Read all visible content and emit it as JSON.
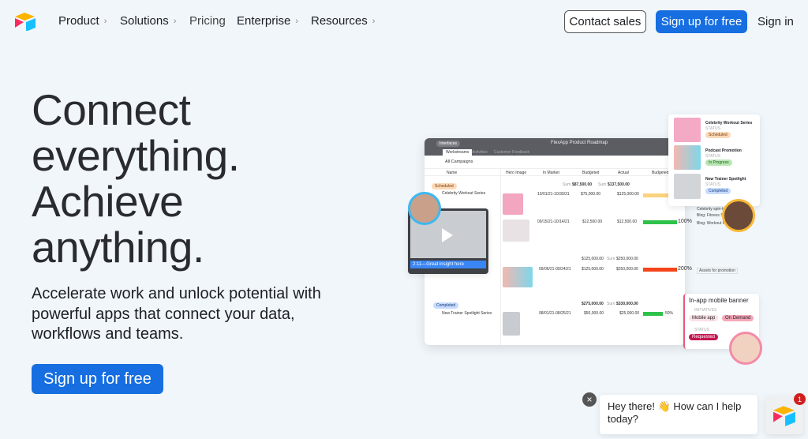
{
  "nav": {
    "items": [
      {
        "label": "Product",
        "chevron": true
      },
      {
        "label": "Solutions",
        "chevron": true
      },
      {
        "label": "Pricing",
        "chevron": false
      },
      {
        "label": "Enterprise",
        "chevron": true
      },
      {
        "label": "Resources",
        "chevron": true
      }
    ],
    "contact_sales": "Contact sales",
    "sign_up": "Sign up for free",
    "sign_in": "Sign in"
  },
  "hero": {
    "headline": [
      "Connect",
      "everything.",
      "Achieve",
      "anything."
    ],
    "subtitle": "Accelerate work and unlock potential with powerful apps that connect your data, workflows and teams.",
    "cta": "Sign up for free"
  },
  "mockup": {
    "interfaces_label": "Interfaces",
    "title": "FlexApp Product Roadmap",
    "tabs": [
      "Workstreams",
      "Activities",
      "Customer Feedback"
    ],
    "view": "All Campaigns",
    "columns": [
      "Name",
      "Hero Image",
      "In Market",
      "Budgeted",
      "Actual",
      "Budgeted vs."
    ],
    "groups": [
      {
        "status_label": "STATUS",
        "status": "Scheduled",
        "sum_budgeted": "$87,500.00",
        "sum_actual": "$137,500.00"
      },
      {
        "status_label": "STATUS",
        "status": "Completed",
        "sum_budgeted": "$275,000.00",
        "sum_actual": "$330,000.00"
      }
    ],
    "sum_label": "Sum",
    "rows": [
      {
        "name": "Celebrity Workout Series",
        "in_market": "10/01/21-10/30/31",
        "budgeted": "$75,000.00",
        "actual": "$125,000.00",
        "pct": "",
        "fill": 0.9,
        "color": "#fcd27e",
        "note": "Celebrity spin-to-ad"
      },
      {
        "name": "",
        "in_market": "09/15/21-10/14/21",
        "budgeted": "$12,500.00",
        "actual": "$12,500.00",
        "pct": "100%",
        "fill": 1,
        "color": "#2ec24a",
        "note": "Blog: Workout Routi"
      },
      {
        "name": "",
        "in_market": "09/06/21-09/24/21",
        "budgeted": "$125,000.00",
        "actual": "$250,000.00",
        "pct": "200%",
        "fill": 1,
        "color": "#f4451a",
        "note": "Assets for promotion",
        "pre_budgeted": "$125,000.00",
        "pre_actual": "$250,000.00"
      },
      {
        "name": "New Trainer Spotlight Series",
        "in_market": "08/01/21-08/25/21",
        "budgeted": "$50,000.00",
        "actual": "$25,000.00",
        "pct": "50%",
        "fill": 0.6,
        "color": "#2ec24a",
        "note": ""
      }
    ],
    "extra_note": "Blog: Fitness Secre",
    "video_caption": "2:11—Great insight here",
    "cards": [
      {
        "title": "Celebrity Workout Series",
        "label": "STATUS",
        "status": "Scheduled",
        "bg": "#fcd9b8",
        "fg": "#7a3e0a"
      },
      {
        "title": "Podcast Promotion",
        "label": "STATUS",
        "status": "In Progress",
        "bg": "#b9e7b4",
        "fg": "#1f5e1a"
      },
      {
        "title": "New Trainer Spotlight",
        "label": "STATUS",
        "status": "Completed",
        "bg": "#c7dcff",
        "fg": "#1a3d7a"
      }
    ],
    "detail": {
      "title": "In-app mobile banner",
      "initiatives_label": "INITIATIVES",
      "tags": [
        "Mobile app",
        "On Demand"
      ],
      "status_label": "STATUS",
      "status": "Requested"
    }
  },
  "chat": {
    "message": "Hey there! 👋 How can I help today?",
    "badge": "1"
  },
  "colors": {
    "accent": "#166ee1",
    "background": "#f0f6fa"
  }
}
